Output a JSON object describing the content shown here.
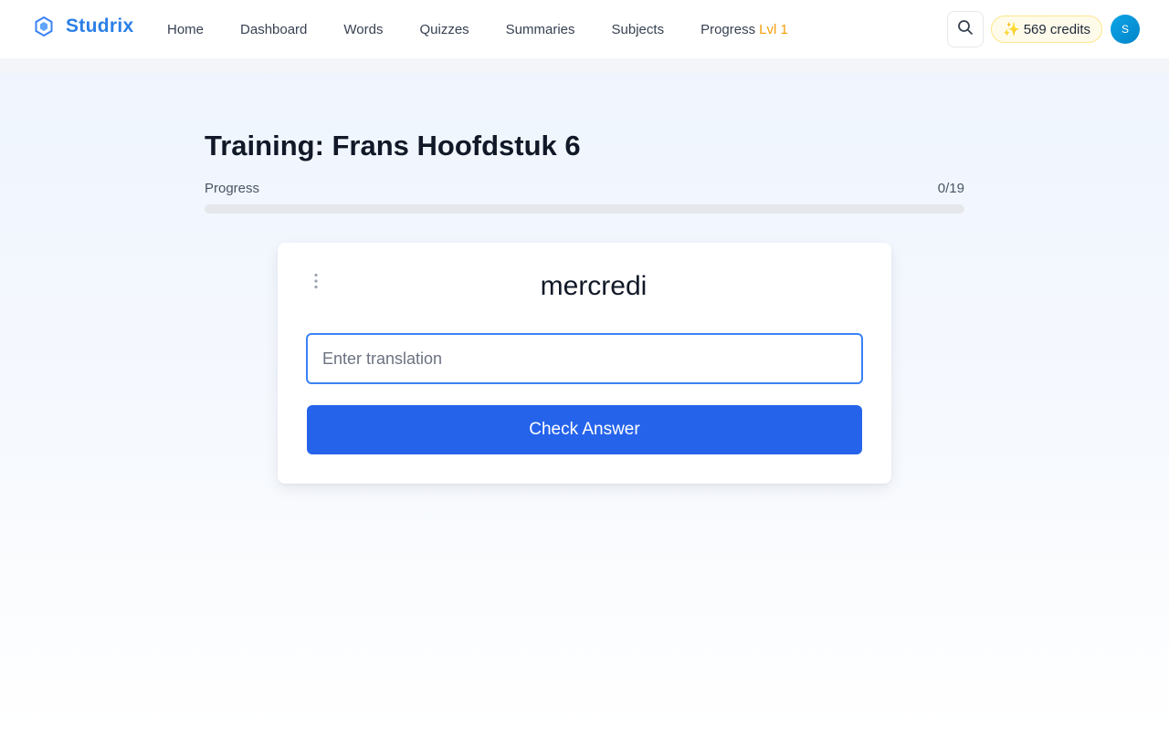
{
  "brand": {
    "name": "Studrix",
    "icon": "hexagon-logo-icon"
  },
  "nav": {
    "links": [
      "Home",
      "Dashboard",
      "Words",
      "Quizzes",
      "Summaries",
      "Subjects"
    ],
    "progress_label": "Progress",
    "progress_level": "Lvl 1"
  },
  "header": {
    "search_icon": "search-icon",
    "credits_icon": "✨",
    "credits_label": "569 credits",
    "avatar_initial": "S"
  },
  "training": {
    "title": "Training: Frans Hoofdstuk 6",
    "progress_label": "Progress",
    "progress_count": "0/19",
    "progress_fraction": 0,
    "word": "mercredi",
    "input_placeholder": "Enter translation",
    "input_value": "",
    "check_button": "Check Answer"
  },
  "colors": {
    "brand": "#2b7fe6",
    "primary_button": "#2563eb",
    "level_accent": "#f59e0b",
    "input_focus_border": "#3b82f6"
  }
}
